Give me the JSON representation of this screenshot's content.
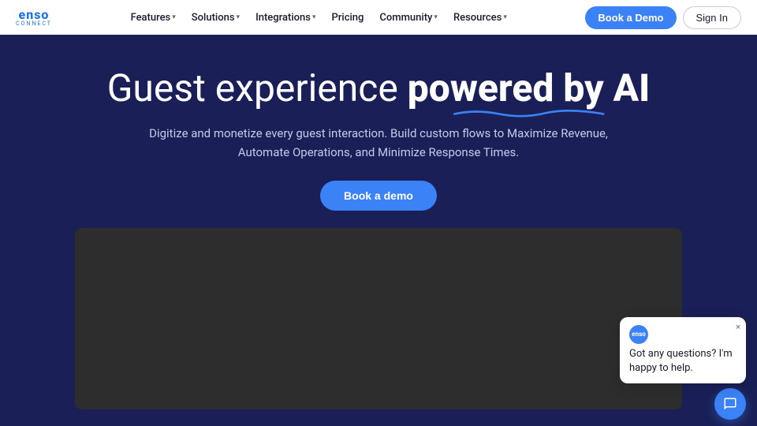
{
  "nav": {
    "logo_text": "enso",
    "logo_sub": "connect",
    "items": [
      {
        "label": "Features",
        "has_dropdown": true
      },
      {
        "label": "Solutions",
        "has_dropdown": true
      },
      {
        "label": "Integrations",
        "has_dropdown": true
      },
      {
        "label": "Pricing",
        "has_dropdown": false
      },
      {
        "label": "Community",
        "has_dropdown": true
      },
      {
        "label": "Resources",
        "has_dropdown": true
      }
    ],
    "book_demo": "Book a Demo",
    "sign_in": "Sign In"
  },
  "hero": {
    "title_plain": "Guest experience ",
    "title_bold": "powered by AI",
    "description": "Digitize and monetize every guest interaction. Build custom flows to Maximize Revenue, Automate Operations, and Minimize Response Times.",
    "cta_label": "Book a demo"
  },
  "chat": {
    "avatar_label": "enso",
    "bubble_text": "Got any questions? I'm happy to help.",
    "close_label": "×"
  }
}
